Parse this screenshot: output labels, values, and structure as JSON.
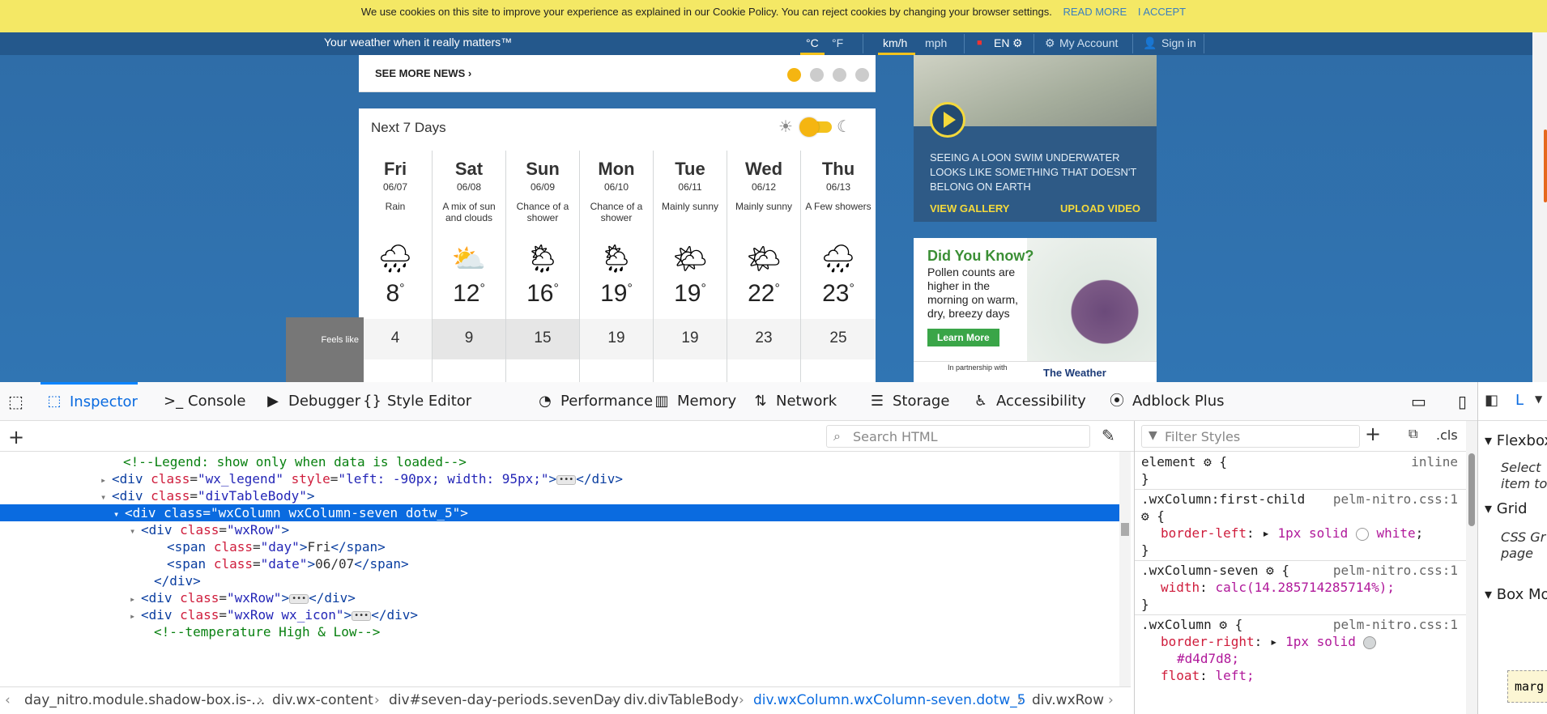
{
  "cookie_banner": {
    "text": "We use cookies on this site to improve your experience as explained in our Cookie Policy. You can reject cookies by changing your browser settings.",
    "read_more": "READ MORE",
    "accept": "I ACCEPT"
  },
  "top_bar": {
    "tagline": "Your weather when it really matters™",
    "units_temp": [
      "°C",
      "°F"
    ],
    "units_speed": [
      "km/h",
      "mph"
    ],
    "language": "EN",
    "my_account": "My Account",
    "sign_in": "Sign in"
  },
  "news": {
    "see_more": "SEE MORE NEWS"
  },
  "forecast": {
    "title": "Next 7 Days",
    "feels_like_label": "Feels like",
    "days": [
      {
        "day": "Fri",
        "date": "06/07",
        "desc": "Rain",
        "high": "8",
        "feels": "4",
        "icon": "rain-cloud-icon"
      },
      {
        "day": "Sat",
        "date": "06/08",
        "desc": "A mix of sun and clouds",
        "high": "12",
        "feels": "9",
        "icon": "sun-cloud-icon"
      },
      {
        "day": "Sun",
        "date": "06/09",
        "desc": "Chance of a shower",
        "high": "16",
        "feels": "15",
        "icon": "sun-shower-icon"
      },
      {
        "day": "Mon",
        "date": "06/10",
        "desc": "Chance of a shower",
        "high": "19",
        "feels": "19",
        "icon": "sun-shower-icon"
      },
      {
        "day": "Tue",
        "date": "06/11",
        "desc": "Mainly sunny",
        "high": "19",
        "feels": "19",
        "icon": "mostly-sunny-icon"
      },
      {
        "day": "Wed",
        "date": "06/12",
        "desc": "Mainly sunny",
        "high": "22",
        "feels": "23",
        "icon": "mostly-sunny-icon"
      },
      {
        "day": "Thu",
        "date": "06/13",
        "desc": "A Few showers",
        "high": "23",
        "feels": "25",
        "icon": "cloud-shower-icon"
      }
    ]
  },
  "media": {
    "caption": "Seeing a loon swim underwater looks like something that doesn't belong on Earth",
    "view_gallery": "VIEW GALLERY",
    "upload_video": "UPLOAD VIDEO"
  },
  "ad": {
    "headline": "Did You Know?",
    "body": "Pollen counts are higher in the morning on warm, dry, breezy days",
    "button": "Learn More",
    "partnership": "In partnership with",
    "brand": "The Weather"
  },
  "devtools": {
    "tabs": [
      "Inspector",
      "Console",
      "Debugger",
      "Style Editor",
      "Performance",
      "Memory",
      "Network",
      "Storage",
      "Accessibility",
      "Adblock Plus"
    ],
    "active_tab": "Inspector",
    "search_placeholder": "Search HTML",
    "filter_placeholder": "Filter Styles",
    "cls_label": ".cls",
    "markup": [
      {
        "comment": "<!--Legend: show only when data is loaded-->"
      },
      {
        "tag": "div",
        "attrs": [
          [
            "class",
            "wx_legend"
          ],
          [
            "style",
            "left: -90px; width: 95px;"
          ]
        ],
        "collapsed": true
      },
      {
        "tag": "div",
        "attrs": [
          [
            "class",
            "divTableBody"
          ]
        ],
        "open": true
      },
      {
        "tag": "div",
        "attrs": [
          [
            "class",
            "wxColumn wxColumn-seven dotw_5"
          ]
        ],
        "open": true,
        "selected": true
      },
      {
        "tag": "div",
        "attrs": [
          [
            "class",
            "wxRow"
          ]
        ],
        "open": true
      },
      {
        "tag": "span",
        "attrs": [
          [
            "class",
            "day"
          ]
        ],
        "text": "Fri"
      },
      {
        "tag": "span",
        "attrs": [
          [
            "class",
            "date"
          ]
        ],
        "text": "06/07"
      },
      {
        "close": "div"
      },
      {
        "tag": "div",
        "attrs": [
          [
            "class",
            "wxRow"
          ]
        ],
        "collapsed": true
      },
      {
        "tag": "div",
        "attrs": [
          [
            "class",
            "wxRow wx_icon"
          ]
        ],
        "collapsed": true
      },
      {
        "comment": "<!--temperature High & Low-->"
      }
    ],
    "breadcrumbs": [
      "day_nitro.module.shadow-box.is-…",
      "div.wx-content",
      "div#seven-day-periods.sevenDay",
      "div.divTableBody",
      "div.wxColumn.wxColumn-seven.dotw_5",
      "div.wxRow"
    ],
    "rules": {
      "element": {
        "selector": "element",
        "source": "inline"
      },
      "r1": {
        "selector": ".wxColumn:first-child",
        "source": "pelm-nitro.css:1",
        "prop": "border-left",
        "value": "1px solid",
        "color": "white"
      },
      "r2": {
        "selector": ".wxColumn-seven",
        "source": "pelm-nitro.css:1",
        "prop": "width",
        "value": "calc(14.285714285714%);"
      },
      "r3": {
        "selector": ".wxColumn",
        "source": "pelm-nitro.css:1",
        "prop": "border-right",
        "value": "1px solid",
        "color": "#d4d7d8;",
        "prop2": "float",
        "value2": "left;"
      }
    },
    "layout": {
      "tab": "L",
      "flexbox": "Flexbox",
      "select_text": "Select item to",
      "grid": "Grid",
      "grid_text": "CSS Gr page",
      "box_model": "Box Mo",
      "margin": "marg"
    }
  },
  "colors": {
    "accent": "#0a84ff",
    "banner": "#f4e865",
    "page_bg": "#2d6aa6",
    "highlight": "#f4c21c"
  }
}
